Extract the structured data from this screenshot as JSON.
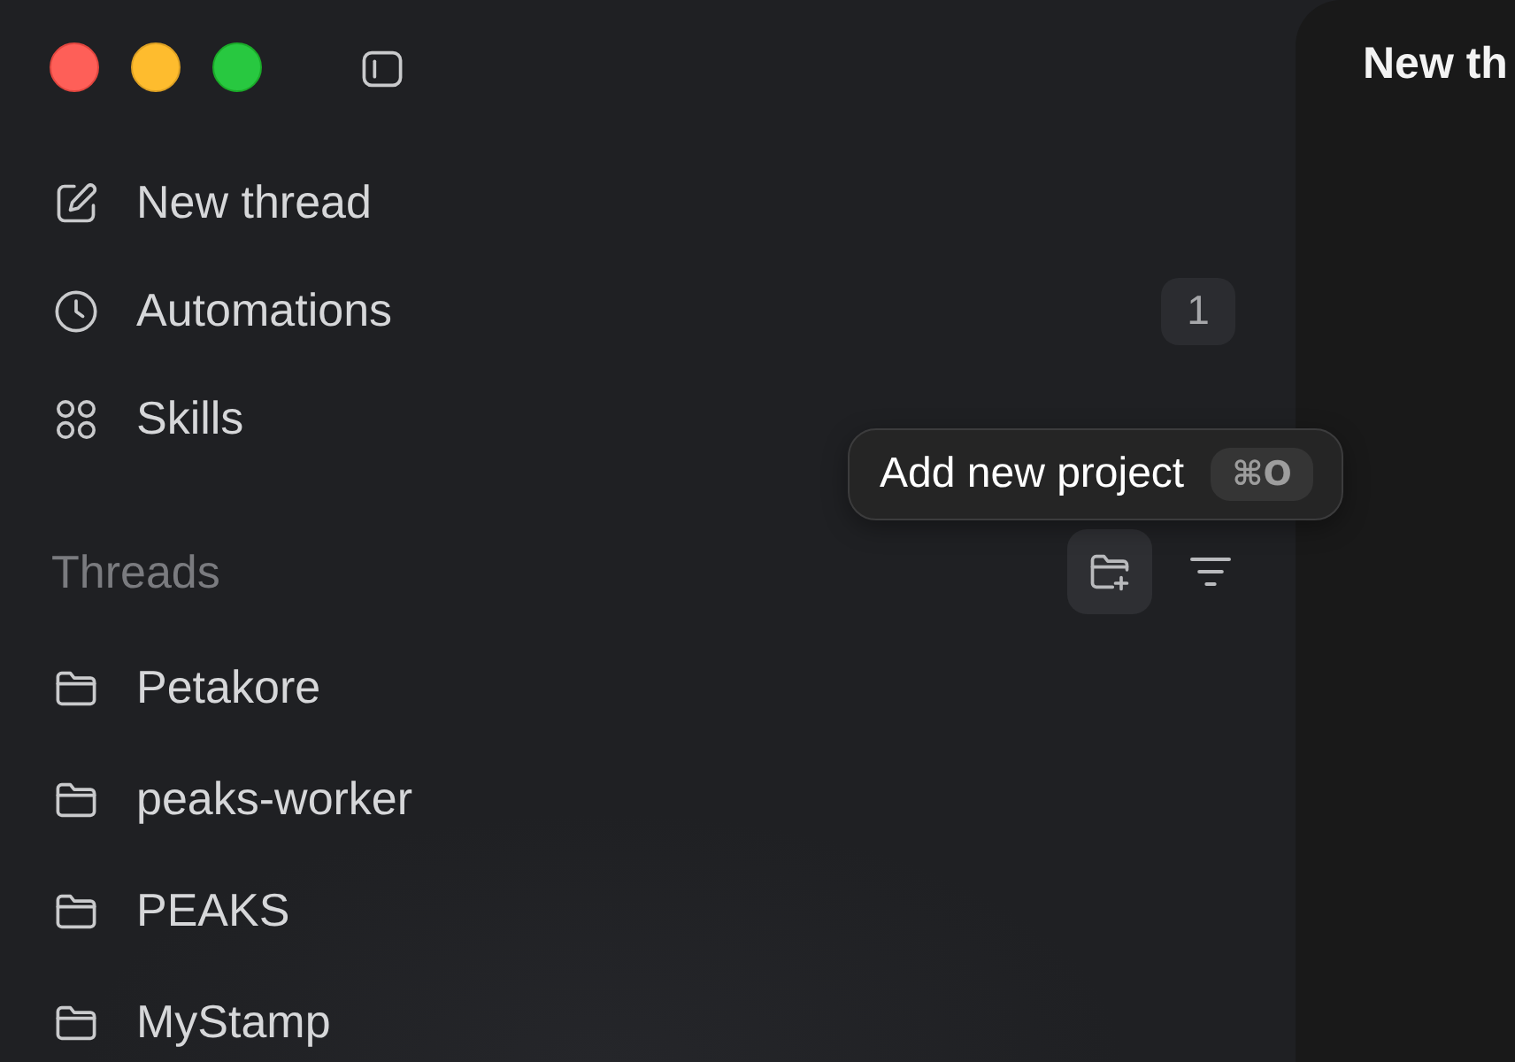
{
  "sidebar": {
    "nav": [
      {
        "kind": "compose",
        "label": "New thread"
      },
      {
        "kind": "clock",
        "label": "Automations",
        "badge": "1"
      },
      {
        "kind": "grid",
        "label": "Skills"
      }
    ],
    "threads": {
      "title": "Threads",
      "actions": [
        {
          "kind": "add-folder",
          "highlighted": true
        },
        {
          "kind": "filter",
          "highlighted": false
        }
      ],
      "projects": [
        {
          "name": "Petakore"
        },
        {
          "name": "peaks-worker"
        },
        {
          "name": "PEAKS"
        },
        {
          "name": "MyStamp"
        }
      ]
    }
  },
  "tooltip": {
    "label": "Add new project",
    "shortcut": "⌘O"
  },
  "main": {
    "title": "New th"
  }
}
